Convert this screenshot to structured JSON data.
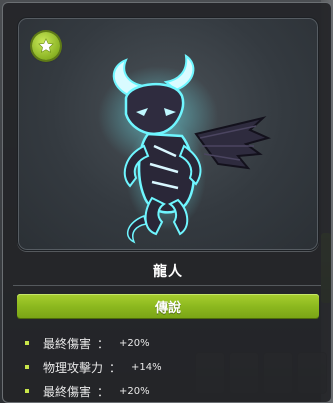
{
  "card": {
    "name": "龍人",
    "grade": "傳說",
    "badge_icon": "star-icon",
    "accent_color": "#8db91f"
  },
  "stats": [
    {
      "label": "最終傷害",
      "sep": "：",
      "value": "+20%"
    },
    {
      "label": "物理攻擊力",
      "sep": "：",
      "value": "+14%"
    },
    {
      "label": "最終傷害",
      "sep": "：",
      "value": "+20%"
    }
  ]
}
